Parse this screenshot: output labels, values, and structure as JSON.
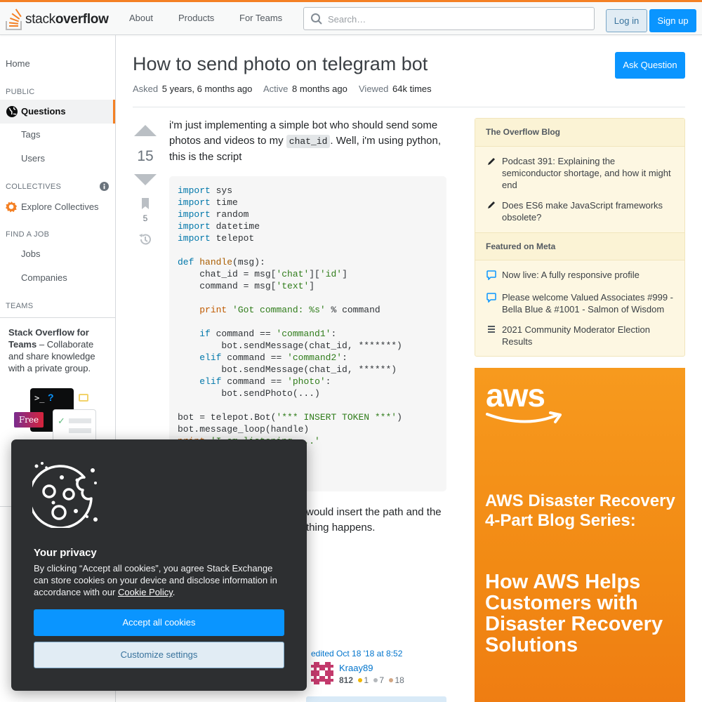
{
  "header": {
    "logo_word_1": "stack",
    "logo_word_2": "overflow",
    "nav": [
      "About",
      "Products",
      "For Teams"
    ],
    "search_placeholder": "Search…",
    "login_label": "Log in",
    "signup_label": "Sign up"
  },
  "sidebar": {
    "home": "Home",
    "public_heading": "PUBLIC",
    "questions": "Questions",
    "tags": "Tags",
    "users": "Users",
    "collectives_heading": "COLLECTIVES",
    "explore_collectives": "Explore Collectives",
    "find_job_heading": "FIND A JOB",
    "jobs": "Jobs",
    "companies": "Companies",
    "teams_heading": "TEAMS",
    "teams_promo_bold": "Stack Overflow for Teams",
    "teams_promo_rest": " – Collaborate and share knowledge with a private group.",
    "free_badge": "Free"
  },
  "question": {
    "title": "How to send photo on telegram bot",
    "ask_button": "Ask Question",
    "asked_label": "Asked",
    "asked_value": "5 years, 6 months ago",
    "active_label": "Active",
    "active_value": "8 months ago",
    "viewed_label": "Viewed",
    "viewed_value": "64k times",
    "votes": "15",
    "bookmarks": "5",
    "body_1_before": "i'm just implementing a simple bot who should send some photos and videos to my ",
    "body_1_code": "chat_id",
    "body_1_after": ". Well, i'm using python, this is the script",
    "body_2_line1": "would insert the path and the",
    "body_2_line2": "thing happens.",
    "edited": "edited Oct 18 '18 at 8:52",
    "editor_name": "Kraay89",
    "editor_rep": "812",
    "badges": {
      "gold": "1",
      "silver": "7",
      "bronze": "18"
    }
  },
  "code_lines": [
    "import sys",
    "import time",
    "import random",
    "import datetime",
    "import telepot",
    "",
    "def handle(msg):",
    "    chat_id = msg['chat']['id']",
    "    command = msg['text']",
    "",
    "    print 'Got command: %s' % command",
    "",
    "    if command == 'command1':",
    "        bot.sendMessage(chat_id, *******)",
    "    elif command == 'command2':",
    "        bot.sendMessage(chat_id, ******)",
    "    elif command == 'photo':",
    "        bot.sendPhoto(...)",
    "",
    "bot = telepot.Bot('*** INSERT TOKEN ***')",
    "bot.message_loop(handle)",
    "print 'I am listening ...'"
  ],
  "right_sidebar": {
    "blog_heading": "The Overflow Blog",
    "blog_items": [
      "Podcast 391: Explaining the semiconductor shortage, and how it might end",
      "Does ES6 make JavaScript frameworks obsolete?"
    ],
    "meta_heading": "Featured on Meta",
    "meta_items": [
      "Now live: A fully responsive profile",
      "Please welcome Valued Associates #999 - Bella Blue & #1001 - Salmon of Wisdom",
      "2021 Community Moderator Election Results"
    ],
    "ad_logo": "aws",
    "ad_heading": "AWS Disaster Recovery 4-Part Blog Series:",
    "ad_subheading": "How AWS Helps Customers with Disaster Recovery Solutions"
  },
  "cookie": {
    "title": "Your privacy",
    "text_before": "By clicking “Accept all cookies”, you agree Stack Exchange can store cookies on your device and disclose information in accordance with our ",
    "policy_link": "Cookie Policy",
    "text_after": ".",
    "accept": "Accept all cookies",
    "customize": "Customize settings"
  },
  "colors": {
    "brand_orange": "#f48024",
    "primary_blue": "#0a95ff",
    "link_blue": "#0074cc"
  }
}
